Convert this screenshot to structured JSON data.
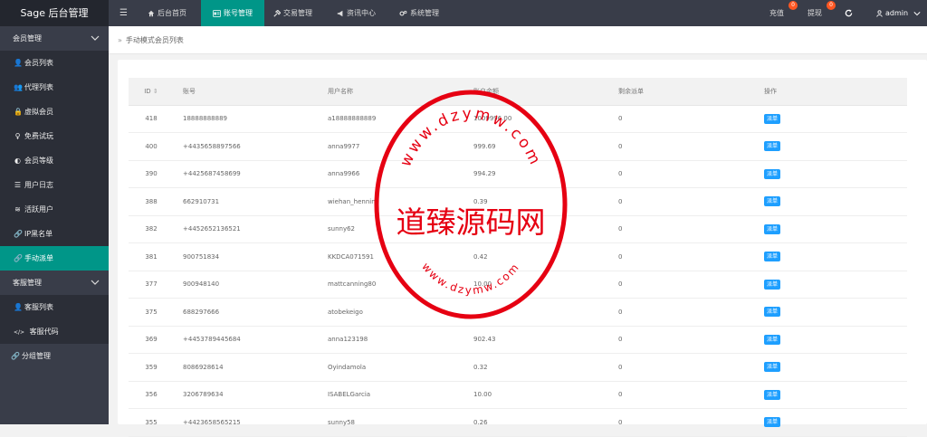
{
  "brand": "Sage 后台管理",
  "topnav": {
    "menu_toggle_glyph": "☰",
    "items": [
      "后台首页",
      "账号管理",
      "交易管理",
      "资讯中心",
      "系统管理"
    ],
    "recharge_label": "充值",
    "recharge_count": "0",
    "withdraw_label": "提现",
    "withdraw_count": "0",
    "user": "admin"
  },
  "sidebar": {
    "groups": [
      "会员管理",
      "客服管理",
      "分组管理"
    ],
    "member_items": [
      "会员列表",
      "代理列表",
      "虚拟会员",
      "免费试玩",
      "会员等级",
      "用户日志",
      "活跃用户",
      "IP黑名单",
      "手动派单"
    ],
    "service_items": [
      "客服列表",
      "客服代码"
    ],
    "code_icon_text": "</>"
  },
  "breadcrumb": {
    "separator": "»",
    "text": "手动模式会员列表"
  },
  "table": {
    "columns": [
      "ID",
      "账号",
      "用户名称",
      "账户余额",
      "剩余派单",
      "操作"
    ],
    "sort_glyph": "⇕",
    "action_label": "派单",
    "rows": [
      [
        "418",
        "18888888889",
        "a18888888889",
        "1009996.00",
        "0"
      ],
      [
        "400",
        "+4435658897566",
        "anna9977",
        "999.69",
        "0"
      ],
      [
        "390",
        "+4425687458699",
        "anna9966",
        "994.29",
        "0"
      ],
      [
        "388",
        "662910731",
        "wiehan_henning",
        "0.39",
        "0"
      ],
      [
        "382",
        "+4452652136521",
        "sunny62",
        "",
        "0"
      ],
      [
        "381",
        "900751834",
        "KKDCA071591",
        "0.42",
        "0"
      ],
      [
        "377",
        "900948140",
        "mattcanning80",
        "10.00",
        "0"
      ],
      [
        "375",
        "688297666",
        "atobekeigo",
        "",
        "0"
      ],
      [
        "369",
        "+4453789445684",
        "anna123198",
        "902.43",
        "0"
      ],
      [
        "359",
        "8086928614",
        "Oyindamola",
        "0.32",
        "0"
      ],
      [
        "356",
        "3206789634",
        "ISABELGarcia",
        "10.00",
        "0"
      ],
      [
        "355",
        "+4423658565215",
        "sunny58",
        "0.26",
        "0"
      ]
    ]
  },
  "watermark": {
    "title": "道臻源码网",
    "top_arc": "www.dzymw.com",
    "bottom_arc": "www.dzymw.com"
  },
  "colors": {
    "topbar": "#393d49",
    "brand_bg": "#23262e",
    "accent": "#009688",
    "button": "#1e9fff",
    "badge": "#ff5722",
    "stamp": "#e60012"
  }
}
